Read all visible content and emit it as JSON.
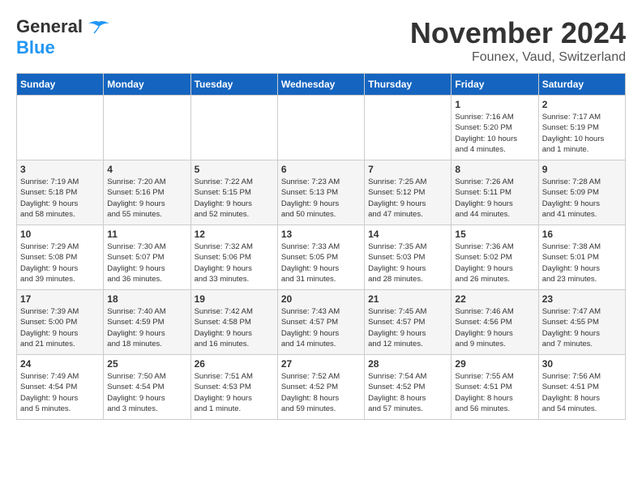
{
  "header": {
    "logo_line1": "General",
    "logo_line2": "Blue",
    "month": "November 2024",
    "location": "Founex, Vaud, Switzerland"
  },
  "days_of_week": [
    "Sunday",
    "Monday",
    "Tuesday",
    "Wednesday",
    "Thursday",
    "Friday",
    "Saturday"
  ],
  "weeks": [
    [
      {
        "day": "",
        "info": ""
      },
      {
        "day": "",
        "info": ""
      },
      {
        "day": "",
        "info": ""
      },
      {
        "day": "",
        "info": ""
      },
      {
        "day": "",
        "info": ""
      },
      {
        "day": "1",
        "info": "Sunrise: 7:16 AM\nSunset: 5:20 PM\nDaylight: 10 hours\nand 4 minutes."
      },
      {
        "day": "2",
        "info": "Sunrise: 7:17 AM\nSunset: 5:19 PM\nDaylight: 10 hours\nand 1 minute."
      }
    ],
    [
      {
        "day": "3",
        "info": "Sunrise: 7:19 AM\nSunset: 5:18 PM\nDaylight: 9 hours\nand 58 minutes."
      },
      {
        "day": "4",
        "info": "Sunrise: 7:20 AM\nSunset: 5:16 PM\nDaylight: 9 hours\nand 55 minutes."
      },
      {
        "day": "5",
        "info": "Sunrise: 7:22 AM\nSunset: 5:15 PM\nDaylight: 9 hours\nand 52 minutes."
      },
      {
        "day": "6",
        "info": "Sunrise: 7:23 AM\nSunset: 5:13 PM\nDaylight: 9 hours\nand 50 minutes."
      },
      {
        "day": "7",
        "info": "Sunrise: 7:25 AM\nSunset: 5:12 PM\nDaylight: 9 hours\nand 47 minutes."
      },
      {
        "day": "8",
        "info": "Sunrise: 7:26 AM\nSunset: 5:11 PM\nDaylight: 9 hours\nand 44 minutes."
      },
      {
        "day": "9",
        "info": "Sunrise: 7:28 AM\nSunset: 5:09 PM\nDaylight: 9 hours\nand 41 minutes."
      }
    ],
    [
      {
        "day": "10",
        "info": "Sunrise: 7:29 AM\nSunset: 5:08 PM\nDaylight: 9 hours\nand 39 minutes."
      },
      {
        "day": "11",
        "info": "Sunrise: 7:30 AM\nSunset: 5:07 PM\nDaylight: 9 hours\nand 36 minutes."
      },
      {
        "day": "12",
        "info": "Sunrise: 7:32 AM\nSunset: 5:06 PM\nDaylight: 9 hours\nand 33 minutes."
      },
      {
        "day": "13",
        "info": "Sunrise: 7:33 AM\nSunset: 5:05 PM\nDaylight: 9 hours\nand 31 minutes."
      },
      {
        "day": "14",
        "info": "Sunrise: 7:35 AM\nSunset: 5:03 PM\nDaylight: 9 hours\nand 28 minutes."
      },
      {
        "day": "15",
        "info": "Sunrise: 7:36 AM\nSunset: 5:02 PM\nDaylight: 9 hours\nand 26 minutes."
      },
      {
        "day": "16",
        "info": "Sunrise: 7:38 AM\nSunset: 5:01 PM\nDaylight: 9 hours\nand 23 minutes."
      }
    ],
    [
      {
        "day": "17",
        "info": "Sunrise: 7:39 AM\nSunset: 5:00 PM\nDaylight: 9 hours\nand 21 minutes."
      },
      {
        "day": "18",
        "info": "Sunrise: 7:40 AM\nSunset: 4:59 PM\nDaylight: 9 hours\nand 18 minutes."
      },
      {
        "day": "19",
        "info": "Sunrise: 7:42 AM\nSunset: 4:58 PM\nDaylight: 9 hours\nand 16 minutes."
      },
      {
        "day": "20",
        "info": "Sunrise: 7:43 AM\nSunset: 4:57 PM\nDaylight: 9 hours\nand 14 minutes."
      },
      {
        "day": "21",
        "info": "Sunrise: 7:45 AM\nSunset: 4:57 PM\nDaylight: 9 hours\nand 12 minutes."
      },
      {
        "day": "22",
        "info": "Sunrise: 7:46 AM\nSunset: 4:56 PM\nDaylight: 9 hours\nand 9 minutes."
      },
      {
        "day": "23",
        "info": "Sunrise: 7:47 AM\nSunset: 4:55 PM\nDaylight: 9 hours\nand 7 minutes."
      }
    ],
    [
      {
        "day": "24",
        "info": "Sunrise: 7:49 AM\nSunset: 4:54 PM\nDaylight: 9 hours\nand 5 minutes."
      },
      {
        "day": "25",
        "info": "Sunrise: 7:50 AM\nSunset: 4:54 PM\nDaylight: 9 hours\nand 3 minutes."
      },
      {
        "day": "26",
        "info": "Sunrise: 7:51 AM\nSunset: 4:53 PM\nDaylight: 9 hours\nand 1 minute."
      },
      {
        "day": "27",
        "info": "Sunrise: 7:52 AM\nSunset: 4:52 PM\nDaylight: 8 hours\nand 59 minutes."
      },
      {
        "day": "28",
        "info": "Sunrise: 7:54 AM\nSunset: 4:52 PM\nDaylight: 8 hours\nand 57 minutes."
      },
      {
        "day": "29",
        "info": "Sunrise: 7:55 AM\nSunset: 4:51 PM\nDaylight: 8 hours\nand 56 minutes."
      },
      {
        "day": "30",
        "info": "Sunrise: 7:56 AM\nSunset: 4:51 PM\nDaylight: 8 hours\nand 54 minutes."
      }
    ]
  ]
}
